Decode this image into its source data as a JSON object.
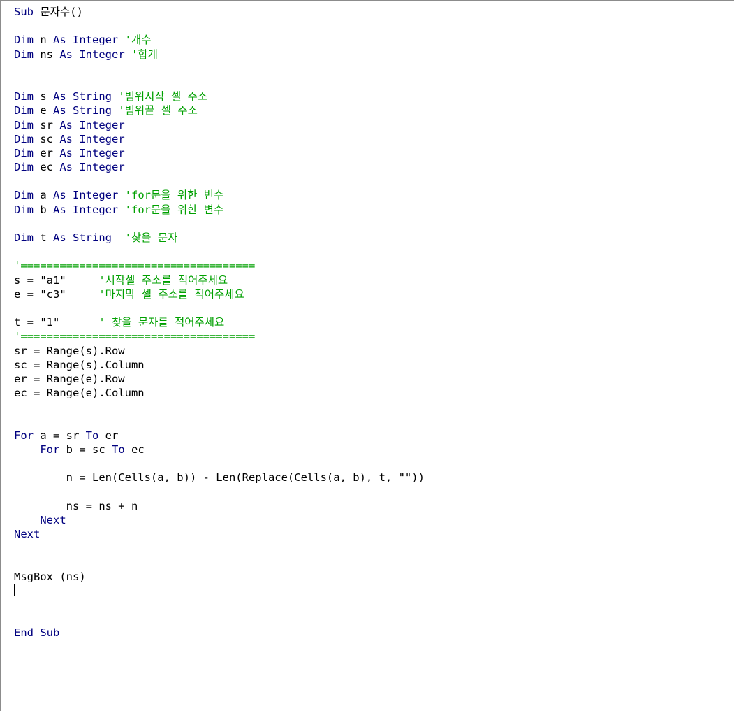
{
  "window": {
    "type": "vba-code-editor"
  },
  "colors": {
    "keyword": "#00007f",
    "comment": "#00a000",
    "text": "#000000",
    "background": "#ffffff"
  },
  "code_lines": [
    [
      {
        "k": "kw",
        "t": "Sub "
      },
      {
        "k": "tx",
        "t": "문자수()"
      }
    ],
    [],
    [
      {
        "k": "kw",
        "t": "Dim "
      },
      {
        "k": "tx",
        "t": "n "
      },
      {
        "k": "kw",
        "t": "As Integer "
      },
      {
        "k": "cm",
        "t": "'개수"
      }
    ],
    [
      {
        "k": "kw",
        "t": "Dim "
      },
      {
        "k": "tx",
        "t": "ns "
      },
      {
        "k": "kw",
        "t": "As Integer "
      },
      {
        "k": "cm",
        "t": "'합계"
      }
    ],
    [],
    [],
    [
      {
        "k": "kw",
        "t": "Dim "
      },
      {
        "k": "tx",
        "t": "s "
      },
      {
        "k": "kw",
        "t": "As String "
      },
      {
        "k": "cm",
        "t": "'범위시작 셀 주소"
      }
    ],
    [
      {
        "k": "kw",
        "t": "Dim "
      },
      {
        "k": "tx",
        "t": "e "
      },
      {
        "k": "kw",
        "t": "As String "
      },
      {
        "k": "cm",
        "t": "'범위끝 셀 주소"
      }
    ],
    [
      {
        "k": "kw",
        "t": "Dim "
      },
      {
        "k": "tx",
        "t": "sr "
      },
      {
        "k": "kw",
        "t": "As Integer"
      }
    ],
    [
      {
        "k": "kw",
        "t": "Dim "
      },
      {
        "k": "tx",
        "t": "sc "
      },
      {
        "k": "kw",
        "t": "As Integer"
      }
    ],
    [
      {
        "k": "kw",
        "t": "Dim "
      },
      {
        "k": "tx",
        "t": "er "
      },
      {
        "k": "kw",
        "t": "As Integer"
      }
    ],
    [
      {
        "k": "kw",
        "t": "Dim "
      },
      {
        "k": "tx",
        "t": "ec "
      },
      {
        "k": "kw",
        "t": "As Integer"
      }
    ],
    [],
    [
      {
        "k": "kw",
        "t": "Dim "
      },
      {
        "k": "tx",
        "t": "a "
      },
      {
        "k": "kw",
        "t": "As Integer "
      },
      {
        "k": "cm",
        "t": "'for문을 위한 변수"
      }
    ],
    [
      {
        "k": "kw",
        "t": "Dim "
      },
      {
        "k": "tx",
        "t": "b "
      },
      {
        "k": "kw",
        "t": "As Integer "
      },
      {
        "k": "cm",
        "t": "'for문을 위한 변수"
      }
    ],
    [],
    [
      {
        "k": "kw",
        "t": "Dim "
      },
      {
        "k": "tx",
        "t": "t "
      },
      {
        "k": "kw",
        "t": "As String  "
      },
      {
        "k": "cm",
        "t": "'찾을 문자"
      }
    ],
    [],
    [
      {
        "k": "cm",
        "t": "'===================================="
      }
    ],
    [
      {
        "k": "tx",
        "t": "s = \"a1\"     "
      },
      {
        "k": "cm",
        "t": "'시작셀 주소를 적어주세요"
      }
    ],
    [
      {
        "k": "tx",
        "t": "e = \"c3\"     "
      },
      {
        "k": "cm",
        "t": "'마지막 셀 주소를 적어주세요"
      }
    ],
    [],
    [
      {
        "k": "tx",
        "t": "t = \"1\"      "
      },
      {
        "k": "cm",
        "t": "' 찾을 문자를 적어주세요"
      }
    ],
    [
      {
        "k": "cm",
        "t": "'===================================="
      }
    ],
    [
      {
        "k": "tx",
        "t": "sr = Range(s).Row"
      }
    ],
    [
      {
        "k": "tx",
        "t": "sc = Range(s).Column"
      }
    ],
    [
      {
        "k": "tx",
        "t": "er = Range(e).Row"
      }
    ],
    [
      {
        "k": "tx",
        "t": "ec = Range(e).Column"
      }
    ],
    [],
    [],
    [
      {
        "k": "kw",
        "t": "For "
      },
      {
        "k": "tx",
        "t": "a = sr "
      },
      {
        "k": "kw",
        "t": "To "
      },
      {
        "k": "tx",
        "t": "er"
      }
    ],
    [
      {
        "k": "tx",
        "t": "    "
      },
      {
        "k": "kw",
        "t": "For "
      },
      {
        "k": "tx",
        "t": "b = sc "
      },
      {
        "k": "kw",
        "t": "To "
      },
      {
        "k": "tx",
        "t": "ec"
      }
    ],
    [],
    [
      {
        "k": "tx",
        "t": "        n = Len(Cells(a, b)) - Len(Replace(Cells(a, b), t, \"\"))"
      }
    ],
    [],
    [
      {
        "k": "tx",
        "t": "        ns = ns + n"
      }
    ],
    [
      {
        "k": "tx",
        "t": "    "
      },
      {
        "k": "kw",
        "t": "Next"
      }
    ],
    [
      {
        "k": "kw",
        "t": "Next"
      }
    ],
    [],
    [],
    [
      {
        "k": "tx",
        "t": "MsgBox (ns)"
      }
    ],
    [
      {
        "k": "caret",
        "t": ""
      }
    ],
    [],
    [],
    [
      {
        "k": "kw",
        "t": "End Sub"
      }
    ]
  ]
}
